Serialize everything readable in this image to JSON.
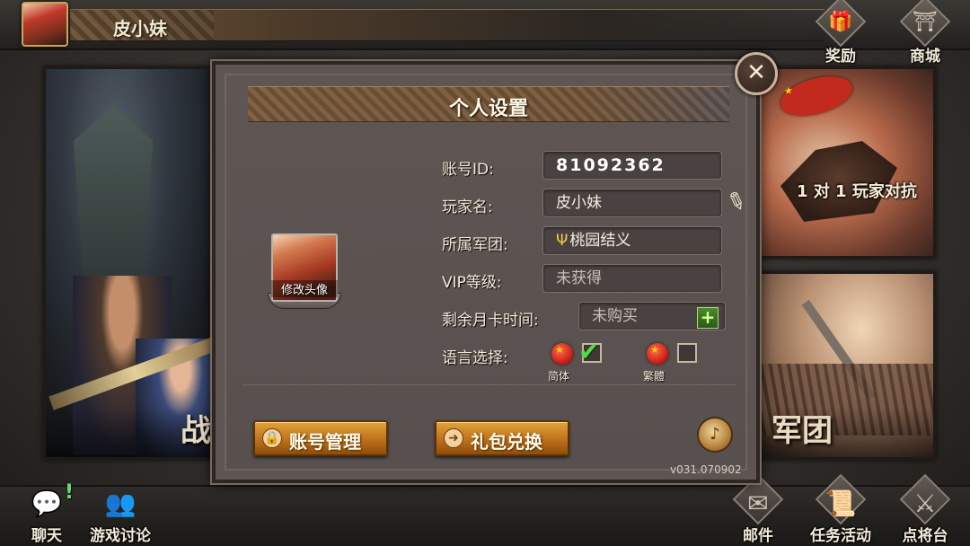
{
  "header": {
    "player_name": "皮小妹",
    "rewards_label": "奖励",
    "shop_label": "商城"
  },
  "background": {
    "left_panel_label": "战",
    "right_top_caption": "1 对 1 玩家对抗",
    "right_bottom_label": "军团"
  },
  "footer": {
    "chat_label": "聊天",
    "chat_badge": "!",
    "discussion_label": "游戏讨论",
    "mail_label": "邮件",
    "quests_label": "任务活动",
    "generals_label": "点将台"
  },
  "dialog": {
    "title": "个人设置",
    "avatar_caption": "修改头像",
    "fields": {
      "account_id_label": "账号ID:",
      "account_id_value": "81092362",
      "player_name_label": "玩家名:",
      "player_name_value": "皮小妹",
      "legion_label": "所属军团:",
      "legion_value": "桃园结义",
      "legion_icon": "trident-icon",
      "vip_label": "VIP等级:",
      "vip_value": "未获得",
      "monthcard_label": "剩余月卡时间:",
      "monthcard_value": "未购买",
      "language_label": "语言选择:"
    },
    "languages": [
      {
        "label": "简体",
        "checked": true
      },
      {
        "label": "繁體",
        "checked": false
      }
    ],
    "buttons": {
      "account_manage": "账号管理",
      "gift_redeem": "礼包兑换"
    },
    "version": "v031.070902"
  },
  "colors": {
    "button_orange": "#c97a22",
    "check_green": "#59d848",
    "dialog_bg": "#5e5553"
  }
}
